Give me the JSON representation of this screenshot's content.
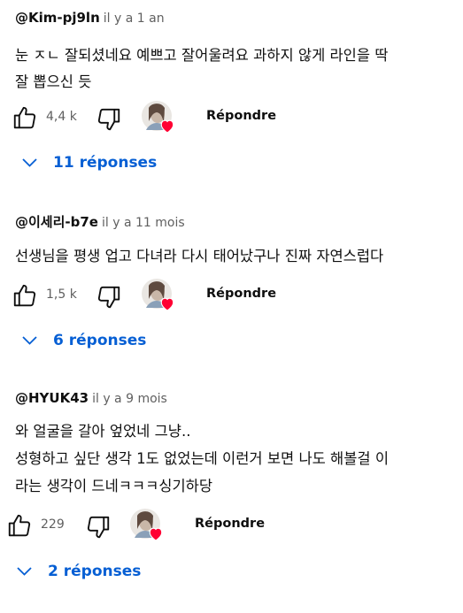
{
  "comments": [
    {
      "author": "@Kim-pj9ln",
      "time": "il y a 1 an",
      "lines": [
        "눈 ㅈㄴ 잘되셨네요 예쁘고 잘어울려요 과하지 않게 라인을 딱",
        "잘 뽑으신 듯"
      ],
      "likes": "4,4 k",
      "reply_label": "Répondre",
      "replies_label": "11 réponses"
    },
    {
      "author": "@이세리-b7e",
      "time": "il y a 11 mois",
      "lines": [
        "선생님을 평생 업고 다녀라 다시 태어났구나 진짜 자연스럽다"
      ],
      "likes": "1,5 k",
      "reply_label": "Répondre",
      "replies_label": "6 réponses"
    },
    {
      "author": "@HYUK43",
      "time": "il y a 9 mois",
      "lines": [
        "와 얼굴을 갈아 엎었네 그냥..",
        "성형하고 싶단 생각 1도 없었는데 이런거 보면 나도 해볼걸 이",
        "라는 생각이 드네ㅋㅋㅋ싱기하당"
      ],
      "likes": "229",
      "reply_label": "Répondre",
      "replies_label": "2 réponses"
    }
  ],
  "icons": {
    "like": "thumbs-up-icon",
    "dislike": "thumbs-down-icon",
    "heart": "heart-icon",
    "chevron": "chevron-down-icon"
  },
  "colors": {
    "link_blue": "#065fd4",
    "meta_gray": "#606060",
    "heart_red": "#ff0033"
  }
}
